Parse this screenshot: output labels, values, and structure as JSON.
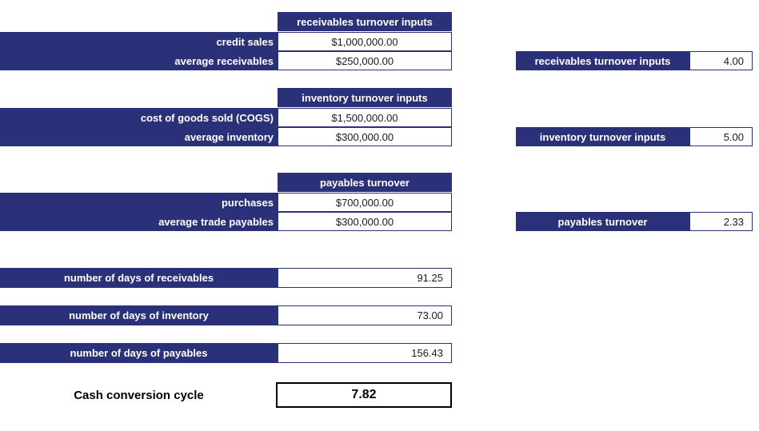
{
  "spreadsheet": {
    "colors": {
      "header_fill": "#2B3178",
      "header_text": "#FFFFFF",
      "value_text": "#1A1A1A",
      "cell_border": "#2B3178",
      "result_border": "#000000",
      "background": "#FFFFFF"
    },
    "input_tables": [
      {
        "header": "receivables turnover inputs",
        "rows": [
          {
            "label": "credit sales",
            "value": "$1,000,000.00"
          },
          {
            "label": "average receivables",
            "value": "$250,000.00"
          }
        ]
      },
      {
        "header": "inventory turnover inputs",
        "rows": [
          {
            "label": "cost of goods sold (COGS)",
            "value": "$1,500,000.00"
          },
          {
            "label": "average inventory",
            "value": "$300,000.00"
          }
        ]
      },
      {
        "header": "payables turnover",
        "rows": [
          {
            "label": "purchases",
            "value": "$700,000.00"
          },
          {
            "label": "average trade payables",
            "value": "$300,000.00"
          }
        ]
      }
    ],
    "turnover_results": [
      {
        "label": "receivables turnover inputs",
        "value": "4.00"
      },
      {
        "label": "inventory turnover inputs",
        "value": "5.00"
      },
      {
        "label": "payables turnover",
        "value": "2.33"
      }
    ],
    "days_results": [
      {
        "label": "number of days of receivables",
        "value": "91.25"
      },
      {
        "label": "number of days of inventory",
        "value": "73.00"
      },
      {
        "label": "number of days of payables",
        "value": "156.43"
      }
    ],
    "summary": {
      "label": "Cash conversion cycle",
      "value": "7.82"
    }
  }
}
